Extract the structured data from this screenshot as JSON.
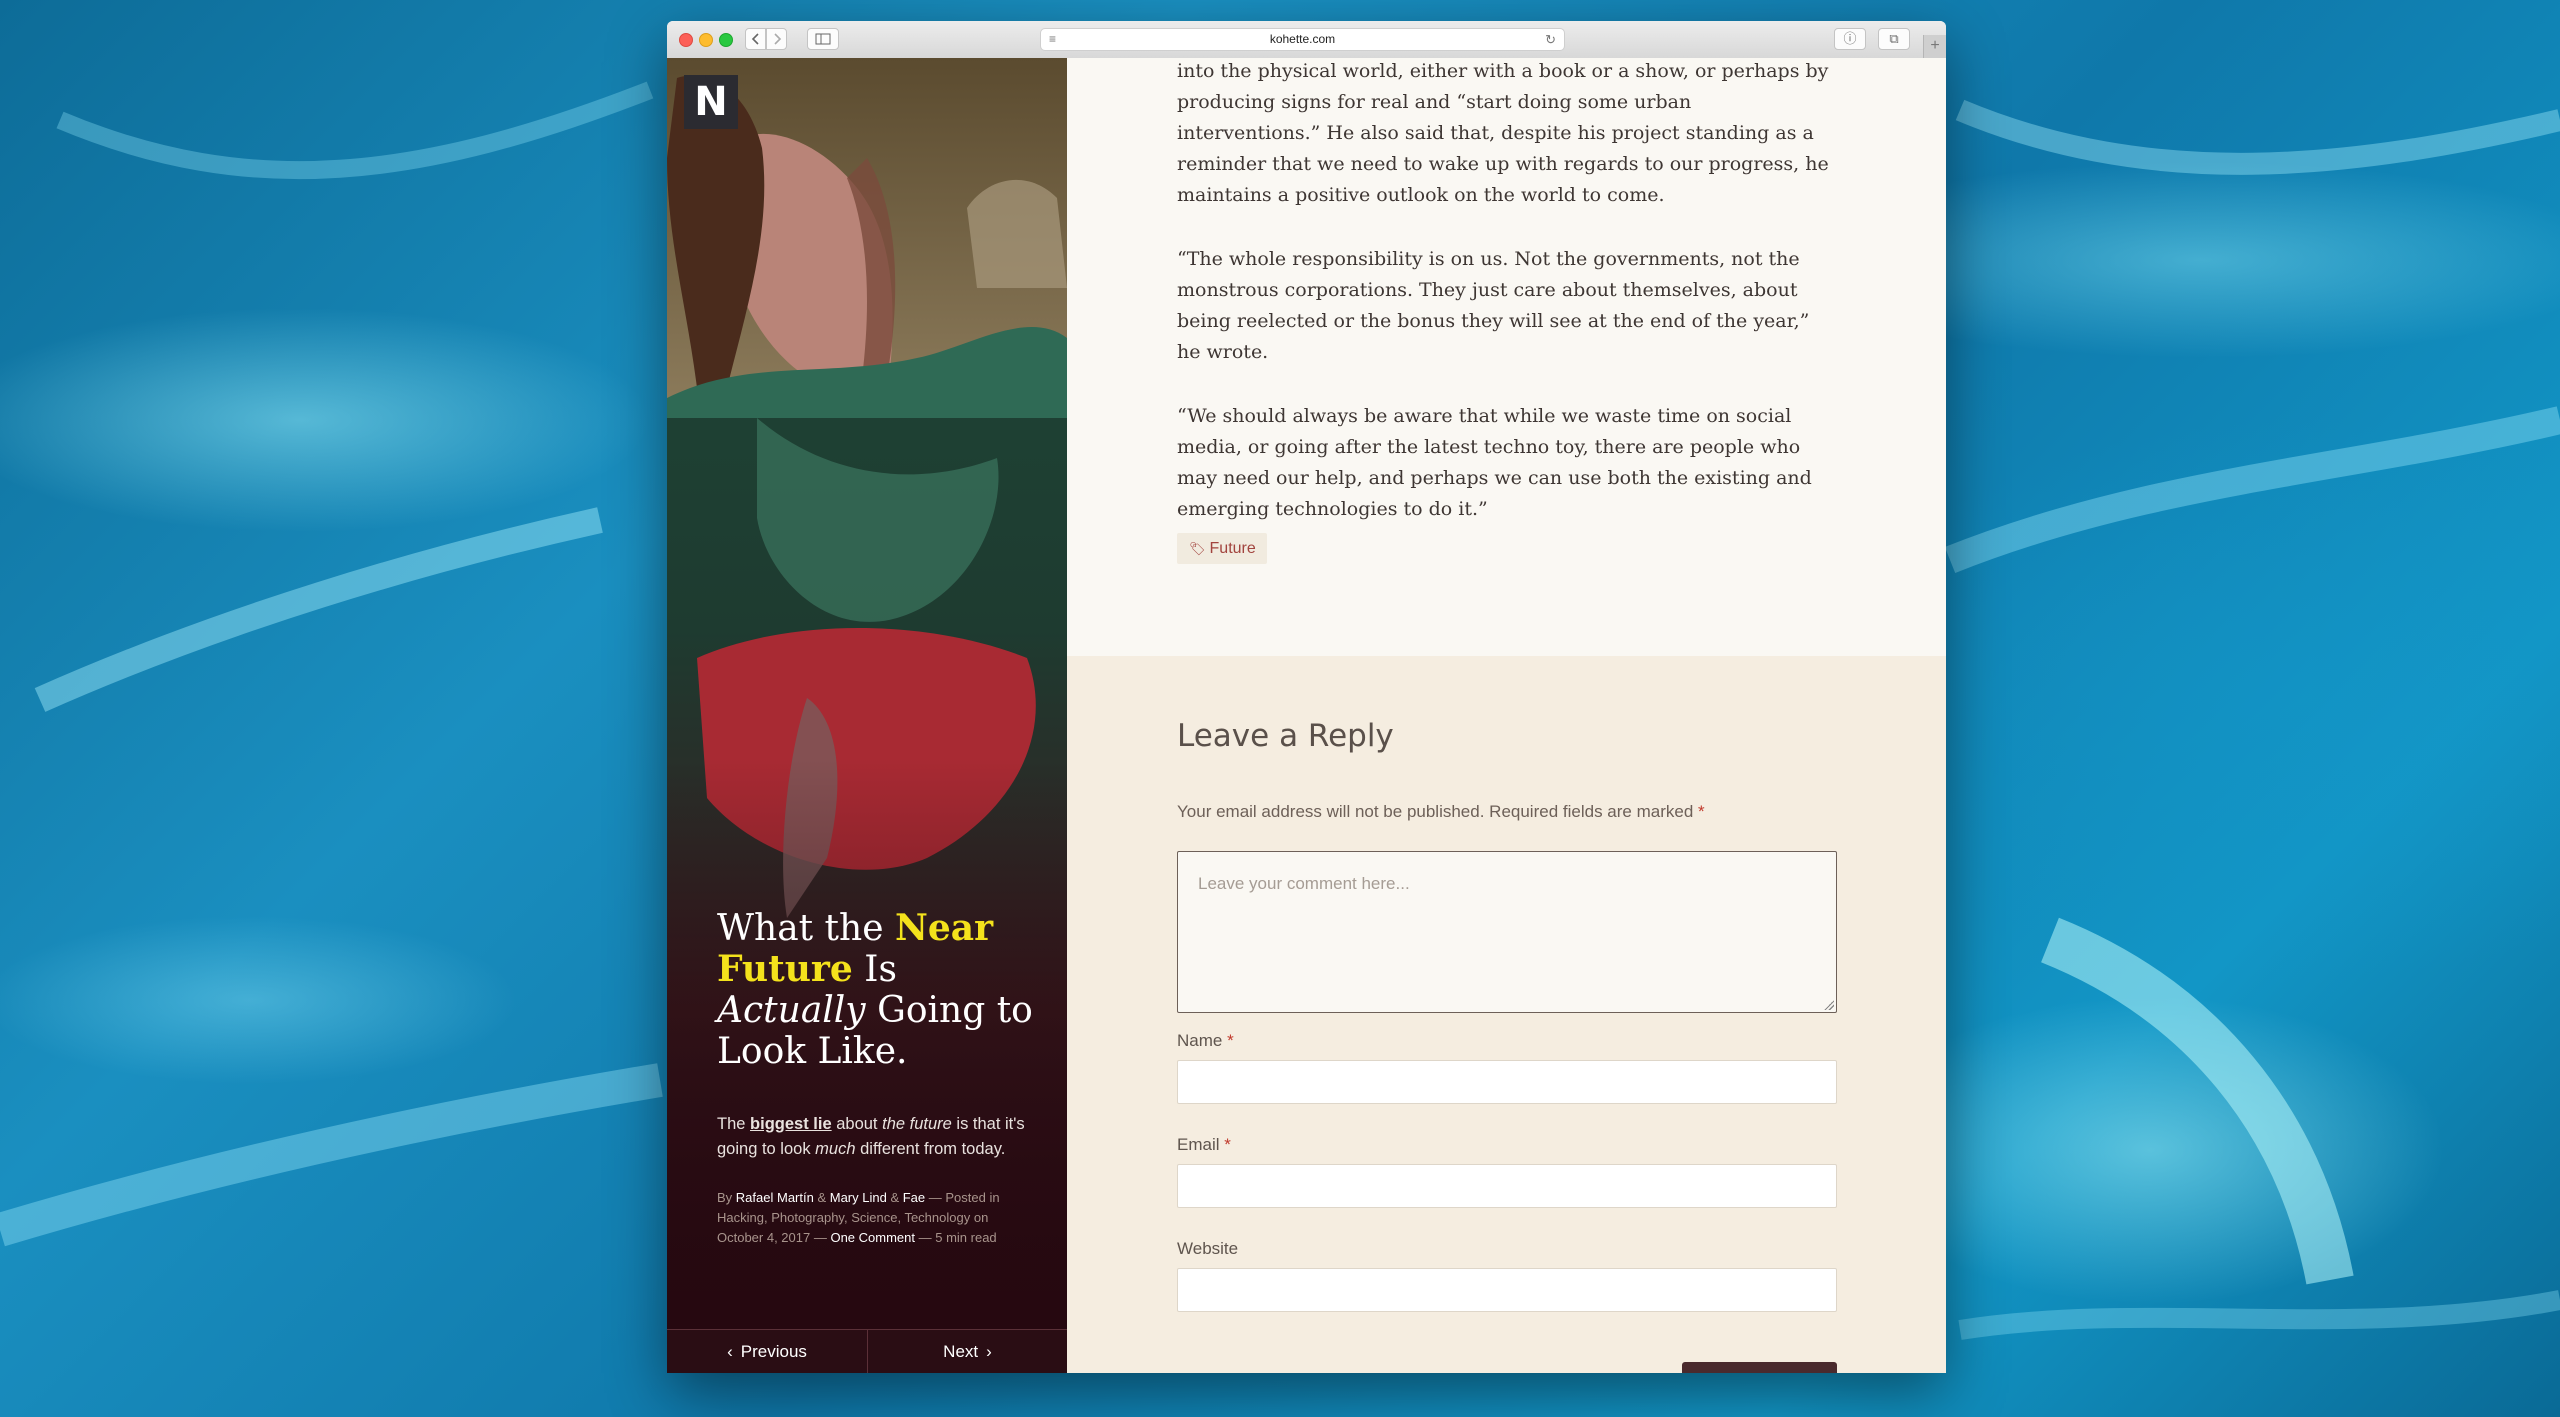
{
  "browser": {
    "url": "kohette.com",
    "new_tab_label": "+"
  },
  "sidebar": {
    "logo_letter": "N",
    "headline": {
      "part1": "What the ",
      "accent": "Near Future",
      "part2": " Is ",
      "italic": "Actually",
      "part3": " Going to Look Like."
    },
    "subtitle": {
      "s1": "The ",
      "link": "biggest lie",
      "s2": " about ",
      "em1": "the future",
      "s3": " is that it's going to look ",
      "em2": "much",
      "s4": " different from today."
    },
    "meta": {
      "by": "By ",
      "author1": "Rafael Martín",
      "amp1": " & ",
      "author2": "Mary Lind",
      "amp2": " & ",
      "author3": "Fae",
      "posted_in": " — Posted in ",
      "categories": [
        "Hacking",
        "Photography",
        "Science",
        "Technology"
      ],
      "on": " on ",
      "date": "October 4, 2017",
      "dash": " — ",
      "comments": "One Comment",
      "read_time": " — 5 min read"
    },
    "nav": {
      "previous": "Previous",
      "next": "Next"
    }
  },
  "article": {
    "paragraphs": [
      "into the physical world, either with a book or a show, or perhaps by producing signs for real and “start doing some urban interventions.” He also said that, despite his project standing as a reminder that we need to wake up with regards to our progress, he maintains a positive outlook on the world to come.",
      "“The whole responsibility is on us. Not the governments, not the monstrous corporations. They just care about themselves, about being reelected or the bonus they will see at the end of the year,” he wrote.",
      "“We should always be aware that while we waste time on social media, or going after the latest techno toy, there are people who may need our help, and perhaps we can use both the existing and emerging technologies to do it.”"
    ],
    "tag": "Future"
  },
  "reply": {
    "title": "Leave a Reply",
    "notes": "Your email address will not be published. Required fields are marked",
    "required_mark": "*",
    "comment_placeholder": "Leave your comment here...",
    "name_label": "Name",
    "email_label": "Email",
    "website_label": "Website"
  },
  "colors": {
    "accent_yellow": "#f4e21c",
    "tag_text": "#a2443e",
    "reply_bg": "#f5ede0",
    "article_bg": "#faf8f3"
  },
  "icons": {
    "back": "chevron-left-icon",
    "forward": "chevron-right-icon",
    "sidebar_toggle": "sidebar-icon",
    "reader": "reader-icon",
    "reload": "reload-icon",
    "share": "share-icon",
    "tabs": "tabs-icon",
    "tag": "tag-icon"
  }
}
